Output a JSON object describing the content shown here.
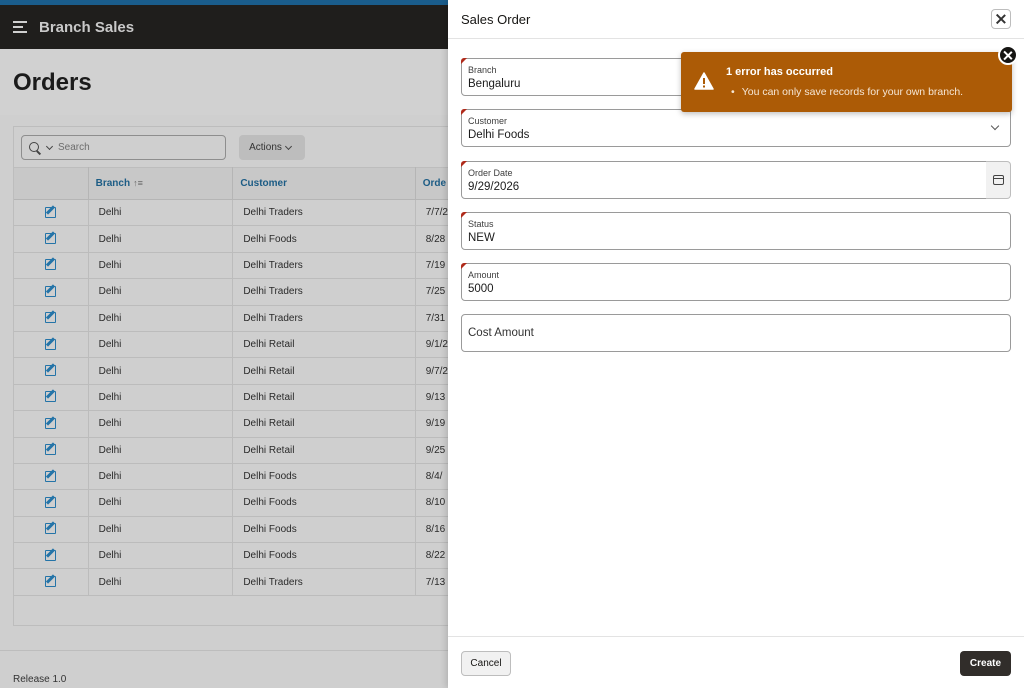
{
  "app": {
    "title": "Branch Sales",
    "page_title": "Orders",
    "footer_text": "Release 1.0"
  },
  "toolbar": {
    "search_placeholder": "Search",
    "actions_label": "Actions"
  },
  "grid": {
    "columns": [
      "Branch",
      "Customer",
      "Orde"
    ],
    "rows": [
      [
        "Delhi",
        "Delhi Traders",
        "7/7/2"
      ],
      [
        "Delhi",
        "Delhi Foods",
        "8/28"
      ],
      [
        "Delhi",
        "Delhi Traders",
        "7/19"
      ],
      [
        "Delhi",
        "Delhi Traders",
        "7/25"
      ],
      [
        "Delhi",
        "Delhi Traders",
        "7/31"
      ],
      [
        "Delhi",
        "Delhi Retail",
        "9/1/2"
      ],
      [
        "Delhi",
        "Delhi Retail",
        "9/7/2"
      ],
      [
        "Delhi",
        "Delhi Retail",
        "9/13"
      ],
      [
        "Delhi",
        "Delhi Retail",
        "9/19"
      ],
      [
        "Delhi",
        "Delhi Retail",
        "9/25"
      ],
      [
        "Delhi",
        "Delhi Foods",
        "8/4/"
      ],
      [
        "Delhi",
        "Delhi Foods",
        "8/10"
      ],
      [
        "Delhi",
        "Delhi Foods",
        "8/16"
      ],
      [
        "Delhi",
        "Delhi Foods",
        "8/22"
      ],
      [
        "Delhi",
        "Delhi Traders",
        "7/13"
      ]
    ]
  },
  "dialog": {
    "title": "Sales Order",
    "fields": {
      "branch": {
        "label": "Branch",
        "value": "Bengaluru"
      },
      "customer": {
        "label": "Customer",
        "value": "Delhi Foods"
      },
      "order_date": {
        "label": "Order Date",
        "value": "9/29/2026"
      },
      "status": {
        "label": "Status",
        "value": "NEW"
      },
      "amount": {
        "label": "Amount",
        "value": "5000"
      },
      "cost_amount": {
        "label": "Cost Amount"
      }
    },
    "cancel_label": "Cancel",
    "create_label": "Create"
  },
  "error": {
    "title": "1 error has occurred",
    "message": "You can only save records for your own branch."
  },
  "colors": {
    "header_bg": "#1f1e1c",
    "accent_stripe": "#1a5d8c",
    "error_bg": "#ac5b06",
    "primary_button": "#312d2a",
    "required_marker": "#b02a1a"
  }
}
